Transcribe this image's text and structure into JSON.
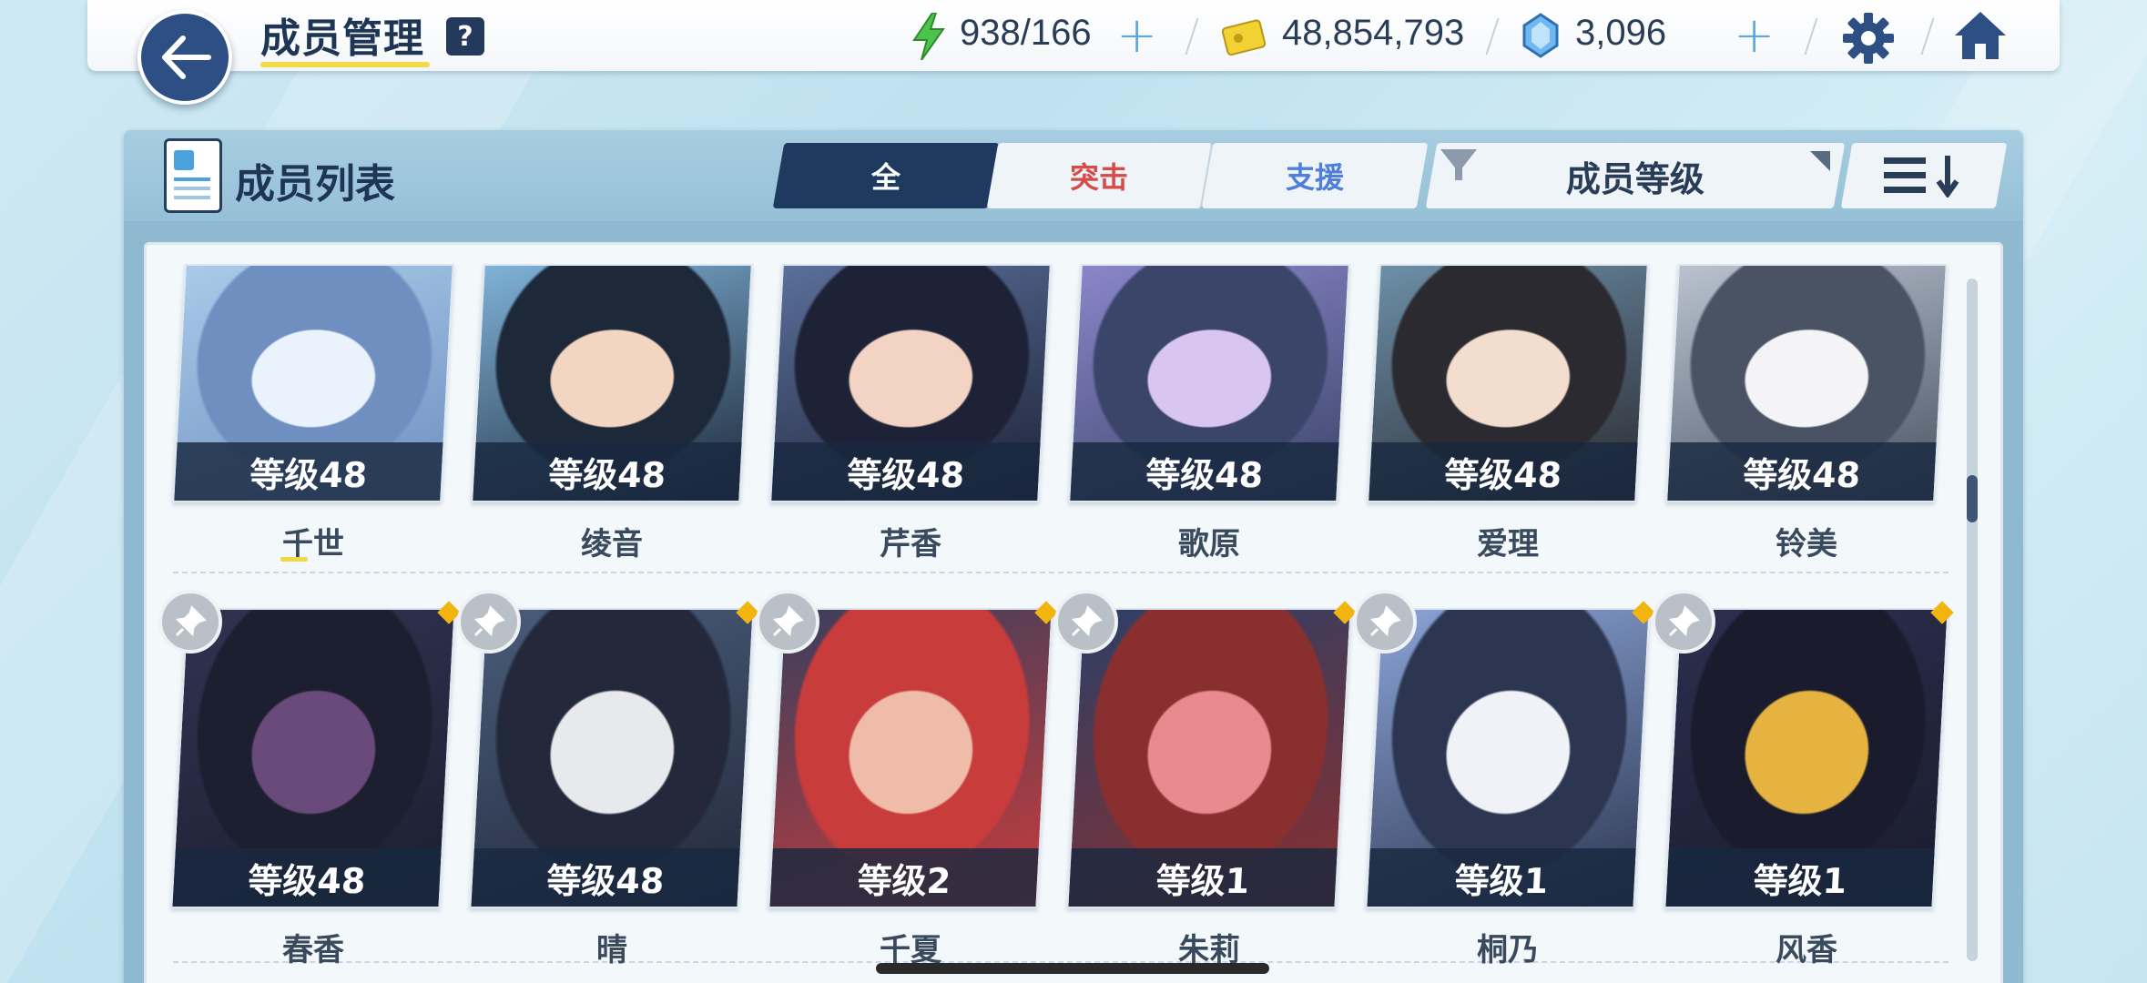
{
  "header": {
    "title": "成员管理",
    "help_label": "?",
    "stamina": "938/166",
    "credits": "48,854,793",
    "gems": "3,096"
  },
  "panel": {
    "title": "成员列表",
    "tabs": [
      {
        "label": "全",
        "active": true
      },
      {
        "label": "突击",
        "color": "#d94b4b"
      },
      {
        "label": "支援",
        "color": "#4f7fd9"
      }
    ],
    "sort_label": "成员等级"
  },
  "students": [
    {
      "name": "千世",
      "level": "等级48",
      "palette": [
        "#a9cbe8",
        "#eaf2fb",
        "#6f8fc1"
      ]
    },
    {
      "name": "绫音",
      "level": "等级48",
      "palette": [
        "#7fb2d8",
        "#f3d6c2",
        "#1d2838"
      ]
    },
    {
      "name": "芹香",
      "level": "等级48",
      "palette": [
        "#5a6f9a",
        "#f2d3c4",
        "#1e2236"
      ]
    },
    {
      "name": "歌原",
      "level": "等级48",
      "palette": [
        "#8a86c9",
        "#d9c6f0",
        "#3a4569"
      ]
    },
    {
      "name": "爱理",
      "level": "等级48",
      "palette": [
        "#6c8fa8",
        "#f2ddcf",
        "#2a2a30"
      ]
    },
    {
      "name": "铃美",
      "level": "等级48",
      "palette": [
        "#b9c2cf",
        "#f4f4f6",
        "#4a5363"
      ]
    },
    {
      "name": "春香",
      "level": "等级48",
      "palette": [
        "#2f3350",
        "#6a4a7a",
        "#1c1f30"
      ]
    },
    {
      "name": "晴",
      "level": "等级48",
      "palette": [
        "#495c7a",
        "#e8e9ec",
        "#23293a"
      ]
    },
    {
      "name": "千夏",
      "level": "等级2",
      "palette": [
        "#3b3e5c",
        "#eebca8",
        "#c83c3c"
      ]
    },
    {
      "name": "朱莉",
      "level": "等级1",
      "palette": [
        "#2d3f66",
        "#e88a8f",
        "#8a2f2f"
      ]
    },
    {
      "name": "桐乃",
      "level": "等级1",
      "palette": [
        "#8aa3d6",
        "#f0f2f7",
        "#2d3650"
      ]
    },
    {
      "name": "风香",
      "level": "等级1",
      "palette": [
        "#2b2f4e",
        "#e6b341",
        "#1a1b2c"
      ]
    }
  ],
  "icons": [
    "back-arrow-icon",
    "help-icon",
    "stamina-bolt-icon",
    "credit-card-icon",
    "pyroxene-gem-icon",
    "plus-icon",
    "gear-icon",
    "home-icon",
    "member-list-icon",
    "filter-icon",
    "sort-order-icon",
    "pin-icon",
    "new-diamond-icon"
  ]
}
